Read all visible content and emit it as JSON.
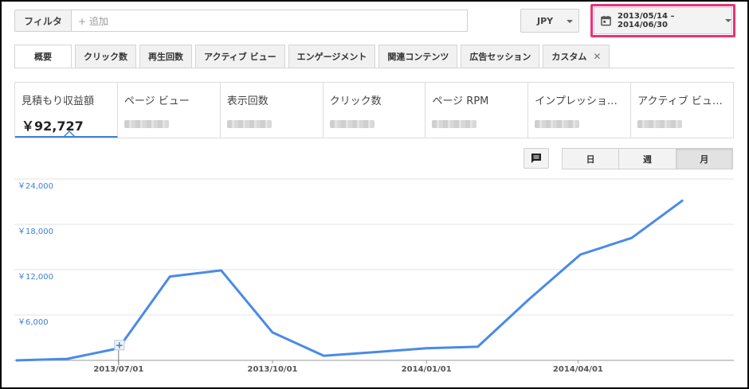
{
  "toolbar": {
    "filter_label": "フィルタ",
    "filter_placeholder": "+ 追加",
    "currency": "JPY",
    "date_range": "2013/05/14 – 2014/06/30"
  },
  "tabs": [
    {
      "label": "概要",
      "active": true
    },
    {
      "label": "クリック数"
    },
    {
      "label": "再生回数"
    },
    {
      "label": "アクティブ ビュー"
    },
    {
      "label": "エンゲージメント"
    },
    {
      "label": "関連コンテンツ"
    },
    {
      "label": "広告セッション"
    },
    {
      "label": "カスタム",
      "closable": true
    }
  ],
  "metrics": [
    {
      "label": "見積もり収益額",
      "value": "￥92,727",
      "active": true
    },
    {
      "label": "ページ ビュー",
      "value": ""
    },
    {
      "label": "表示回数",
      "value": ""
    },
    {
      "label": "クリック数",
      "value": ""
    },
    {
      "label": "ページ RPM",
      "value": ""
    },
    {
      "label": "インプレッショ…",
      "value": ""
    },
    {
      "label": "アクティブ ビュ…",
      "value": ""
    }
  ],
  "period": {
    "day": "日",
    "week": "週",
    "month": "月",
    "selected": "month"
  },
  "colors": {
    "accent": "#4a8ae8",
    "highlight": "#e8337a"
  },
  "chart_data": {
    "type": "line",
    "x": [
      "2013/05",
      "2013/06",
      "2013/07",
      "2013/08",
      "2013/09",
      "2013/10",
      "2013/11",
      "2013/12",
      "2014/01",
      "2014/02",
      "2014/03",
      "2014/04",
      "2014/05",
      "2014/06"
    ],
    "values": [
      0,
      200,
      1600,
      11100,
      11900,
      3700,
      600,
      1100,
      1600,
      1800,
      8100,
      14000,
      16200,
      21200
    ],
    "ytick_labels": [
      "￥6,000",
      "￥12,000",
      "￥18,000",
      "￥24,000"
    ],
    "yticks": [
      6000,
      12000,
      18000,
      24000
    ],
    "ylim": [
      0,
      24000
    ],
    "xtick_labels": [
      "2013/07/01",
      "2013/10/01",
      "2014/01/01",
      "2014/04/01"
    ],
    "grid": true
  }
}
